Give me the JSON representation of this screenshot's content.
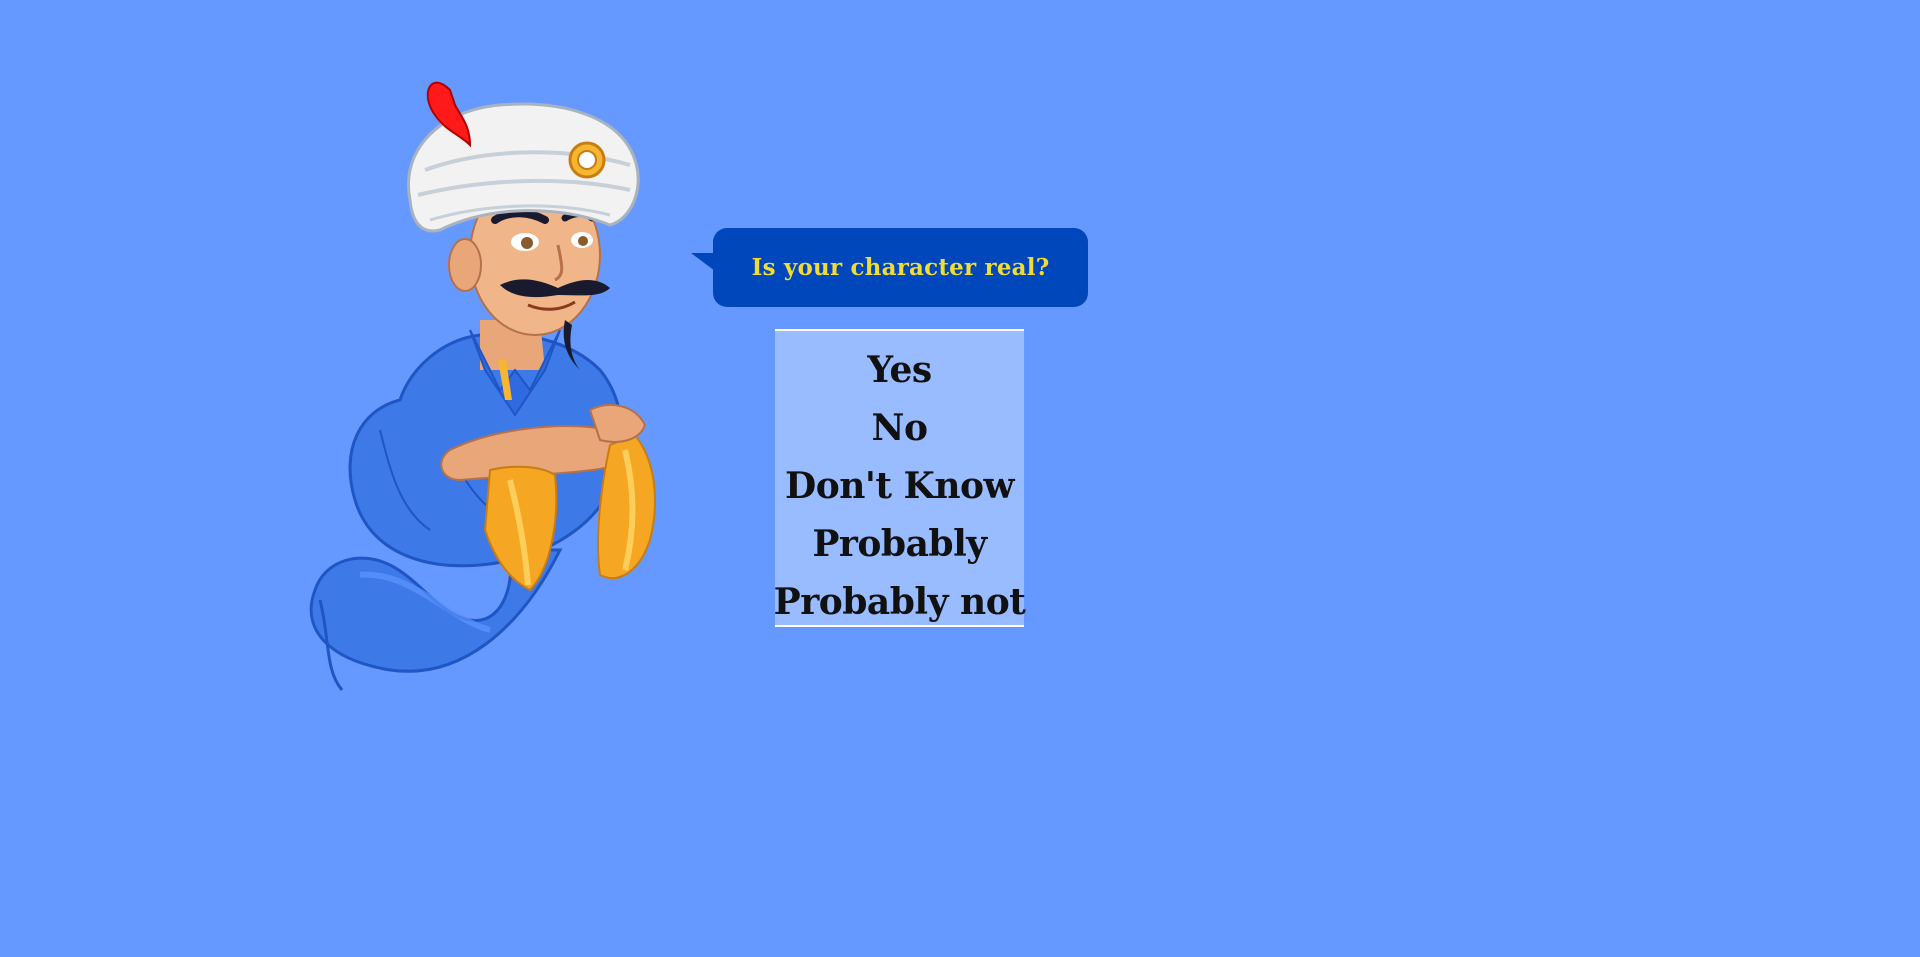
{
  "question": {
    "text": "Is your character real?"
  },
  "answers": [
    {
      "label": "Yes"
    },
    {
      "label": "No"
    },
    {
      "label": "Don't Know"
    },
    {
      "label": "Probably"
    },
    {
      "label": "Probably not"
    }
  ],
  "colors": {
    "background": "#6699ff",
    "bubble": "#0047bb",
    "question_text": "#f2dc32",
    "answer_panel": "#99bbff",
    "answer_text": "#111111"
  },
  "genie": {
    "icon": "genie-mascot-illustration"
  }
}
